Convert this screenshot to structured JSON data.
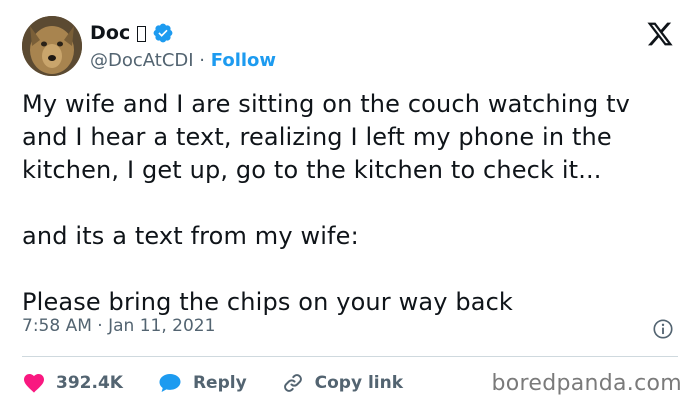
{
  "header": {
    "display_name": "Doc",
    "handle": "@DocAtCDI",
    "separator": "·",
    "follow_label": "Follow"
  },
  "tweet": {
    "paragraphs": [
      "My wife and I are sitting on the couch watching tv and I hear a text, realizing I left my phone in the kitchen, I get up, go to the kitchen to check it...",
      "and its a text from my wife:",
      "Please bring the chips on your way back"
    ],
    "time": "7:58 AM",
    "date": "Jan 11, 2021",
    "meta_separator": "·"
  },
  "actions": {
    "likes": "392.4K",
    "reply_label": "Reply",
    "copy_link_label": "Copy link"
  },
  "watermark": "boredpanda.com",
  "colors": {
    "accent": "#1d9bf0",
    "like": "#f91880",
    "text": "#0f1419",
    "secondary": "#536471",
    "divider": "#cfd9de"
  },
  "icons": {
    "verified": "verified-badge-icon",
    "x_logo": "x-logo-icon",
    "info": "info-icon",
    "like": "heart-icon",
    "reply": "speech-bubble-icon",
    "copy_link": "link-icon"
  }
}
